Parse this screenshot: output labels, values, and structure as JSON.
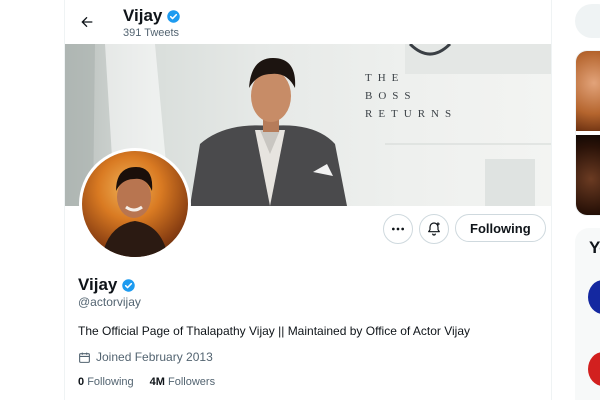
{
  "header": {
    "name": "Vijay",
    "tweet_count": "391 Tweets"
  },
  "banner": {
    "lines": [
      "THE",
      "BOSS",
      "RETURNS"
    ]
  },
  "actions": {
    "following_label": "Following"
  },
  "profile": {
    "name": "Vijay",
    "handle": "@actorvijay",
    "bio": "The Official Page of Thalapathy Vijay || Maintained by Office of Actor Vijay",
    "joined": "Joined February 2013",
    "following_count": "0",
    "following_label": "Following",
    "followers_count": "4M",
    "followers_label": "Followers"
  },
  "sidebar": {
    "suggest_title_fragment": "Yo"
  },
  "icons": {
    "back": "arrow-left-icon",
    "verified": "verified-badge-icon",
    "more": "more-dots-icon",
    "notify": "bell-plus-icon",
    "calendar": "calendar-icon"
  },
  "colors": {
    "verified_blue": "#1d9bf0",
    "text_primary": "#0f1419",
    "text_secondary": "#536471",
    "border": "#cfd9de"
  }
}
